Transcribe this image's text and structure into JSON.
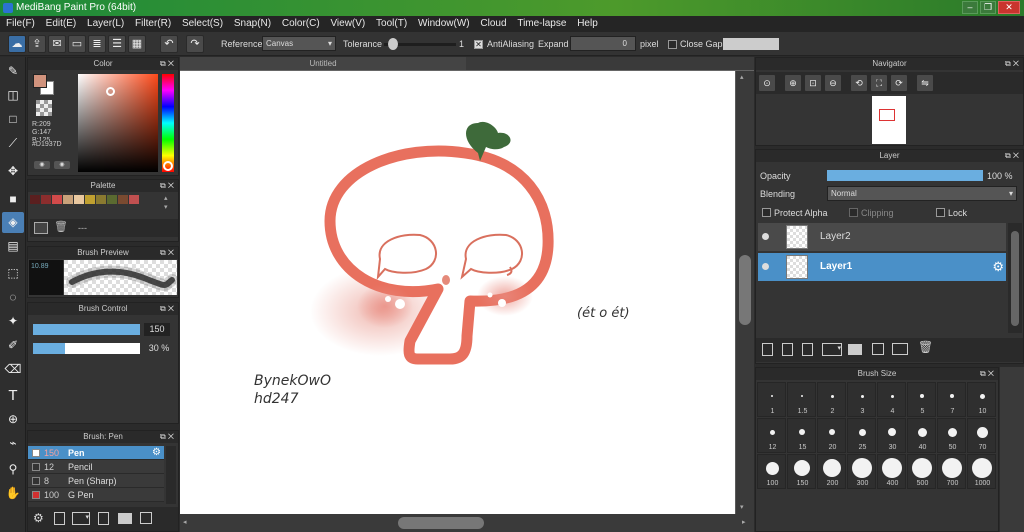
{
  "window": {
    "title": "MediBang Paint Pro (64bit)",
    "min": "–",
    "max": "❐",
    "close": "✕"
  },
  "menu": [
    "File(F)",
    "Edit(E)",
    "Layer(L)",
    "Filter(R)",
    "Select(S)",
    "Snap(N)",
    "Color(C)",
    "View(V)",
    "Tool(T)",
    "Window(W)",
    "Cloud",
    "Time-lapse",
    "Help"
  ],
  "toolbar": {
    "reference_label": "Reference",
    "reference_value": "Canvas",
    "tolerance_label": "Tolerance",
    "tolerance_value": "1",
    "tolerance_fraction": 0.05,
    "antialiasing_label": "AntiAliasing",
    "expand_label": "Expand",
    "expand_value": "0",
    "expand_unit": "pixel",
    "close_gaps_label": "Close Gaps"
  },
  "color_panel": {
    "title": "Color",
    "r": "R:209",
    "g": "G:147",
    "b": "B:125",
    "hex": "#D1937D",
    "fg": "#d1937d",
    "bg": "#ffffff"
  },
  "palette": {
    "title": "Palette",
    "swatches": [
      "#5a1f1f",
      "#8b2d2d",
      "#d24a4a",
      "#c9a27a",
      "#e9c8a0",
      "#c0a030",
      "#8a7a30",
      "#5a6a30",
      "#7a4a30",
      "#c05050"
    ],
    "dash": "---"
  },
  "brush_preview": {
    "title": "Brush Preview",
    "size": "10.89"
  },
  "brush_control": {
    "title": "Brush Control",
    "size_value": "150",
    "size_fraction": 1.0,
    "opacity_value": "30 %",
    "opacity_fraction": 0.3
  },
  "brush_list": {
    "title": "Brush: Pen",
    "items": [
      {
        "size": "150",
        "name": "Pen",
        "selected": true,
        "color": "#ffffff"
      },
      {
        "size": "12",
        "name": "Pencil",
        "selected": false,
        "color": "#333333"
      },
      {
        "size": "8",
        "name": "Pen (Sharp)",
        "selected": false,
        "color": "#333333"
      },
      {
        "size": "100",
        "name": "G Pen",
        "selected": false,
        "color": "#d03030"
      }
    ]
  },
  "canvas": {
    "tab": "Untitled",
    "handwriting_right": "(ét o ét)",
    "signature_line1": "BynekOwO",
    "signature_line2": "hd247"
  },
  "navigator": {
    "title": "Navigator"
  },
  "layer_panel": {
    "title": "Layer",
    "opacity_label": "Opacity",
    "opacity_value": "100 %",
    "opacity_fraction": 1.0,
    "blending_label": "Blending",
    "blending_value": "Normal",
    "protect_alpha": "Protect Alpha",
    "clipping": "Clipping",
    "lock": "Lock",
    "layers": [
      {
        "name": "Layer2",
        "selected": false
      },
      {
        "name": "Layer1",
        "selected": true
      }
    ]
  },
  "brush_size": {
    "title": "Brush Size",
    "sizes": [
      "1",
      "1.5",
      "2",
      "3",
      "4",
      "5",
      "7",
      "10",
      "12",
      "15",
      "20",
      "25",
      "30",
      "40",
      "50",
      "70",
      "100",
      "150",
      "200",
      "300",
      "400",
      "500",
      "700",
      "1000"
    ]
  }
}
